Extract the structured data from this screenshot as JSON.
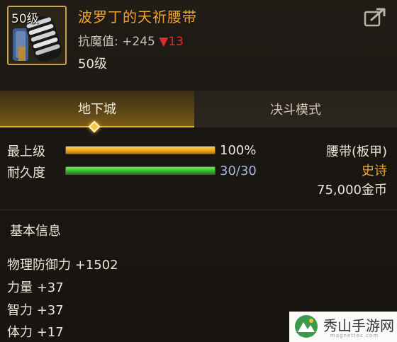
{
  "item": {
    "level_badge": "50级",
    "name": "波罗丁的天祈腰带",
    "magic_resist_label": "抗魔值:",
    "magic_resist_value": "+245",
    "magic_resist_delta_icon": "▼",
    "magic_resist_delta": "13",
    "level_text": "50级"
  },
  "tabs": [
    {
      "label": "地下城",
      "active": true
    },
    {
      "label": "决斗模式",
      "active": false
    }
  ],
  "stats": {
    "max_level_label": "最上级",
    "max_level_value": "100%",
    "max_level_fraction": 1.0,
    "durability_label": "耐久度",
    "durability_value": "30/30",
    "durability_fraction": 1.0
  },
  "meta": {
    "type": "腰带(板甲)",
    "rarity": "史诗",
    "rarity_color": "#f0a32c",
    "price": "75,000金币"
  },
  "basic_info": {
    "title": "基本信息",
    "attributes": [
      "物理防御力 +1502",
      "力量 +37",
      "智力 +37",
      "体力 +17"
    ]
  },
  "watermark": {
    "text": "秀山手游网",
    "sub": "magnettec.com"
  },
  "icons": {
    "share": "share-export-icon",
    "diamond": "diamond-marker-icon",
    "item": "belt-item-icon"
  }
}
